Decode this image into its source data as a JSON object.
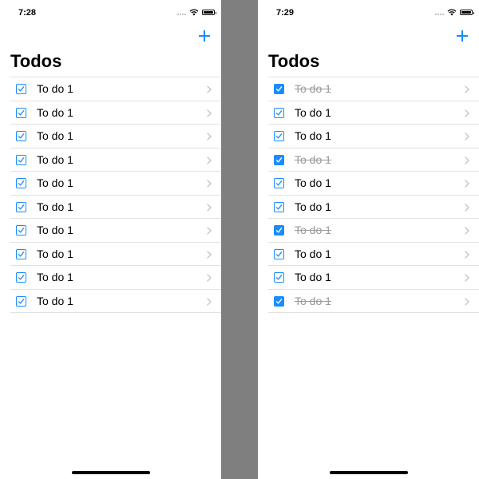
{
  "colors": {
    "accent": "#1a8cff",
    "divider": "#7f7f7f",
    "done_text": "#9a9a9a"
  },
  "screens": [
    {
      "time": "7:28",
      "title": "Todos",
      "todos": [
        {
          "label": "To do 1",
          "done": false
        },
        {
          "label": "To do 1",
          "done": false
        },
        {
          "label": "To do 1",
          "done": false
        },
        {
          "label": "To do 1",
          "done": false
        },
        {
          "label": "To do 1",
          "done": false
        },
        {
          "label": "To do 1",
          "done": false
        },
        {
          "label": "To do 1",
          "done": false
        },
        {
          "label": "To do 1",
          "done": false
        },
        {
          "label": "To do 1",
          "done": false
        },
        {
          "label": "To do 1",
          "done": false
        }
      ]
    },
    {
      "time": "7:29",
      "title": "Todos",
      "todos": [
        {
          "label": "To do 1",
          "done": true
        },
        {
          "label": "To do 1",
          "done": false
        },
        {
          "label": "To do 1",
          "done": false
        },
        {
          "label": "To do 1",
          "done": true
        },
        {
          "label": "To do 1",
          "done": false
        },
        {
          "label": "To do 1",
          "done": false
        },
        {
          "label": "To do 1",
          "done": true
        },
        {
          "label": "To do 1",
          "done": false
        },
        {
          "label": "To do 1",
          "done": false
        },
        {
          "label": "To do 1",
          "done": true
        }
      ]
    }
  ]
}
